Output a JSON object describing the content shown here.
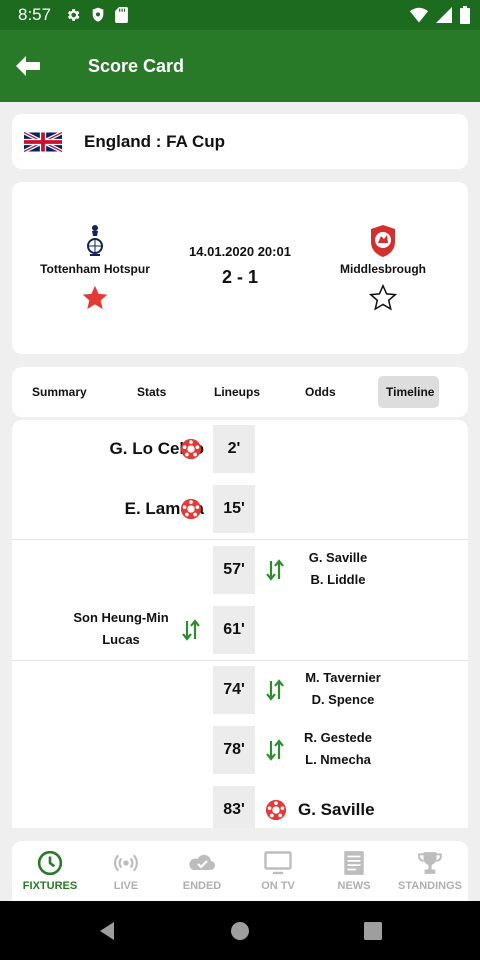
{
  "statusbar": {
    "time": "8:57"
  },
  "appbar": {
    "title": "Score Card"
  },
  "league": {
    "name": "England : FA Cup"
  },
  "match": {
    "home": {
      "name": "Tottenham Hotspur"
    },
    "away": {
      "name": "Middlesbrough"
    },
    "datetime": "14.01.2020 20:01",
    "score": "2 - 1"
  },
  "tabs": [
    {
      "label": "Summary"
    },
    {
      "label": "Stats"
    },
    {
      "label": "Lineups"
    },
    {
      "label": "Odds"
    },
    {
      "label": "Timeline"
    }
  ],
  "timeline": [
    {
      "minute": "2'",
      "type": "goal",
      "side": "home",
      "player": "G. Lo Celso"
    },
    {
      "minute": "15'",
      "type": "goal",
      "side": "home",
      "player": "E. Lamela"
    },
    {
      "minute": "57'",
      "type": "sub",
      "side": "away",
      "in": "G. Saville",
      "out": "B. Liddle"
    },
    {
      "minute": "61'",
      "type": "sub",
      "side": "home",
      "in": "Son Heung-Min",
      "out": "Lucas"
    },
    {
      "minute": "74'",
      "type": "sub",
      "side": "away",
      "in": "M. Tavernier",
      "out": "D. Spence"
    },
    {
      "minute": "78'",
      "type": "sub",
      "side": "away",
      "in": "R. Gestede",
      "out": "L. Nmecha"
    },
    {
      "minute": "83'",
      "type": "goal",
      "side": "away",
      "player": "G. Saville"
    }
  ],
  "bottomnav": [
    {
      "label": "FIXTURES",
      "active": true
    },
    {
      "label": "LIVE"
    },
    {
      "label": "ENDED"
    },
    {
      "label": "ON TV"
    },
    {
      "label": "NEWS"
    },
    {
      "label": "STANDINGS"
    }
  ],
  "colors": {
    "primary_green": "#287a28",
    "status_green": "#1c6b1f",
    "goal_red": "#e53935",
    "sub_green": "#2e8b2e"
  }
}
